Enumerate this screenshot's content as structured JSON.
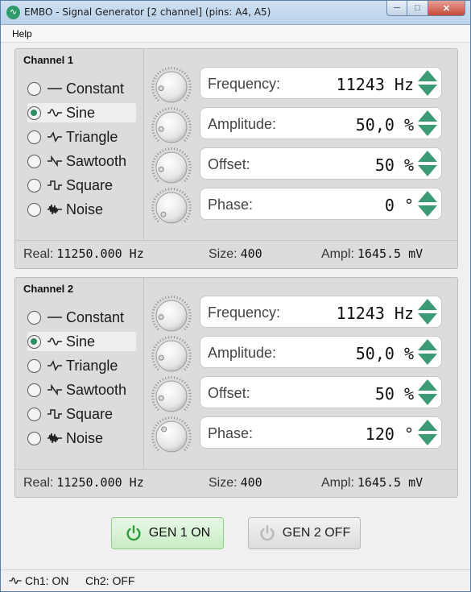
{
  "window": {
    "title": "EMBO - Signal Generator [2 channel] (pins: A4, A5)",
    "app_icon": "signal-wave-icon",
    "buttons": {
      "minimize": "─",
      "maximize": "□",
      "close": "✕"
    }
  },
  "menu": {
    "help": "Help"
  },
  "waveforms": [
    "Constant",
    "Sine",
    "Triangle",
    "Sawtooth",
    "Square",
    "Noise"
  ],
  "channels": [
    {
      "title": "Channel 1",
      "selected": "Sine",
      "frequency": {
        "label": "Frequency:",
        "value": "11243 Hz"
      },
      "amplitude": {
        "label": "Amplitude:",
        "value": "50,0 %"
      },
      "offset": {
        "label": "Offset:",
        "value": "50 %"
      },
      "phase": {
        "label": "Phase:",
        "value": "0 °"
      },
      "real_label": "Real:",
      "real_value": "11250.000 Hz",
      "size_label": "Size:",
      "size_value": "400",
      "ampl_label": "Ampl:",
      "ampl_value": "1645.5 mV"
    },
    {
      "title": "Channel 2",
      "selected": "Sine",
      "frequency": {
        "label": "Frequency:",
        "value": "11243 Hz"
      },
      "amplitude": {
        "label": "Amplitude:",
        "value": "50,0 %"
      },
      "offset": {
        "label": "Offset:",
        "value": "50 %"
      },
      "phase": {
        "label": "Phase:",
        "value": "120 °"
      },
      "real_label": "Real:",
      "real_value": "11250.000 Hz",
      "size_label": "Size:",
      "size_value": "400",
      "ampl_label": "Ampl:",
      "ampl_value": "1645.5 mV"
    }
  ],
  "buttons": {
    "gen1": "GEN 1 ON",
    "gen2": "GEN 2 OFF"
  },
  "statusbar": {
    "ch1": "Ch1: ON",
    "ch2": "Ch2: OFF"
  },
  "colors": {
    "accent": "#3c9a74",
    "gen_on_bg": "#c7ecc3",
    "gen_off_bg": "#dcdcdc"
  }
}
